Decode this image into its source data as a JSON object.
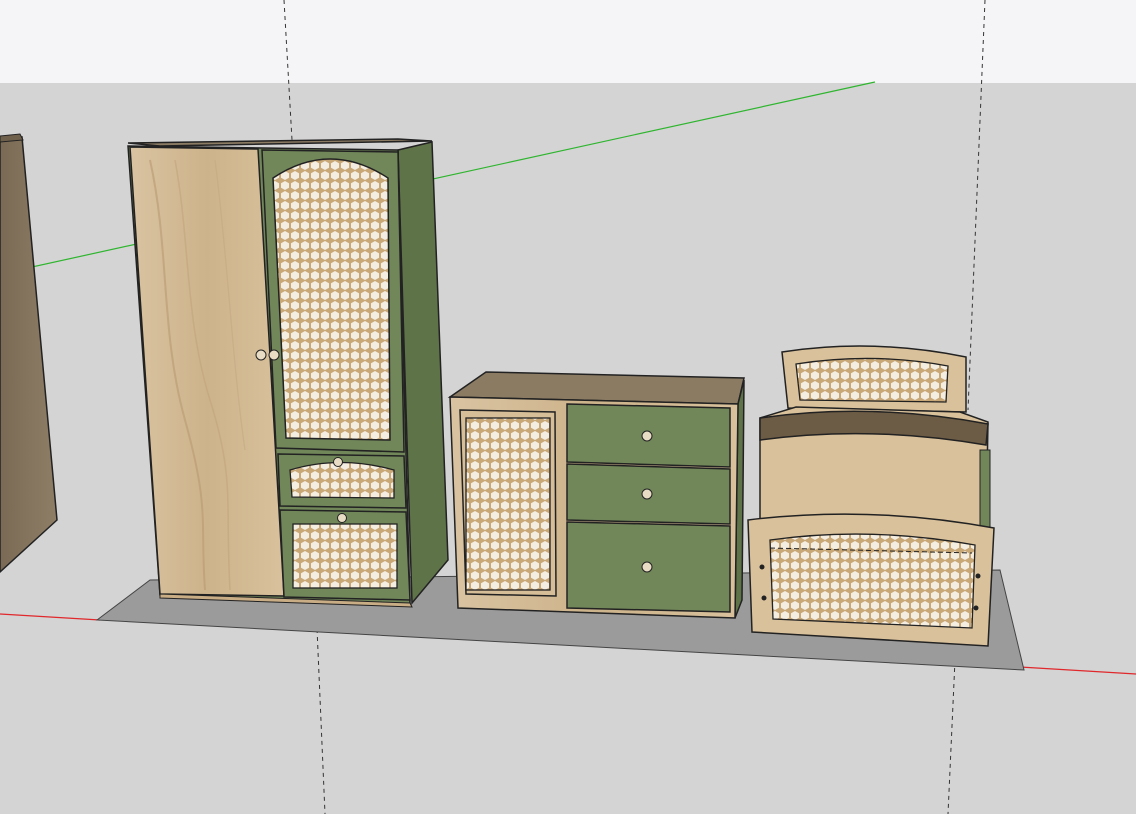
{
  "viewport": {
    "kind": "3d-modeling-viewport",
    "sky_color": "#f5f5f7",
    "ground_color": "#d4d4d4",
    "axes": {
      "green_axis": "#2fb52f",
      "red_axis": "#e0272b",
      "blue_axis_dashed": "#222222"
    }
  },
  "model": {
    "items": [
      {
        "name": "wardrobe",
        "colors": {
          "body": "#71875a",
          "wood": "#d7bf99",
          "cane": "#c9a877"
        }
      },
      {
        "name": "dresser",
        "drawers": 3,
        "colors": {
          "body": "#71875a",
          "wood": "#d6be98",
          "cane": "#c9a877"
        }
      },
      {
        "name": "bed",
        "colors": {
          "wood": "#d9c19b",
          "cane": "#c9a877"
        }
      },
      {
        "name": "side-panel",
        "colors": {
          "wood": "#8c7a62"
        }
      }
    ],
    "floor_color": "#9b9b9b",
    "knob_color": "#e9dcc4"
  }
}
